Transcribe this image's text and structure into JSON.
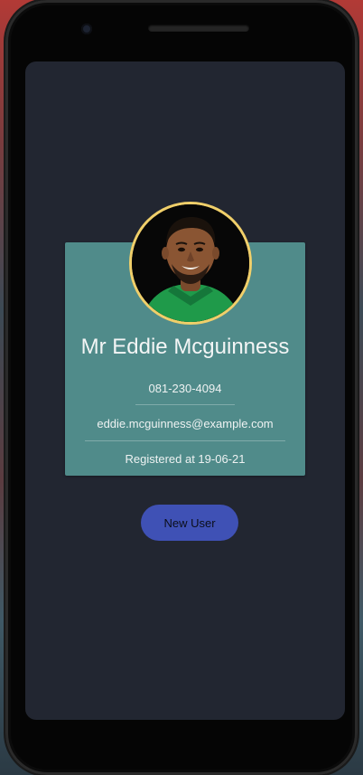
{
  "profile": {
    "name": "Mr Eddie Mcguinness",
    "phone": "081-230-4094",
    "email": "eddie.mcguinness@example.com",
    "registered": "Registered at 19-06-21"
  },
  "actions": {
    "new_user_label": "New User"
  },
  "colors": {
    "screen_background": "#222631",
    "card_background": "#508b8a",
    "avatar_border": "#f0cf6a",
    "button_background": "#3f51b5"
  }
}
